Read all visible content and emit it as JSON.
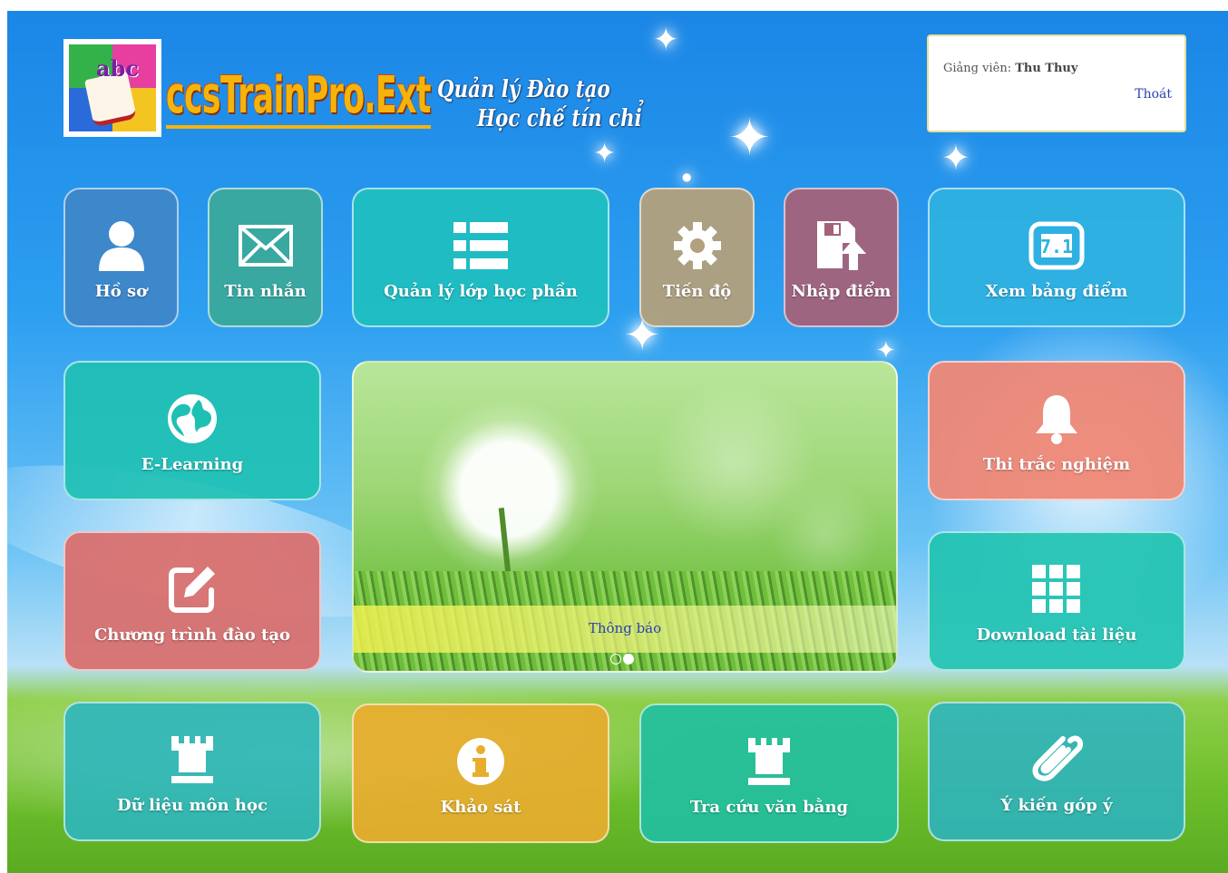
{
  "header": {
    "brand": "ccsTrainPro.Ext",
    "tagline_line1": "Quản lý Đào tạo",
    "tagline_line2": "Học chế tín chỉ",
    "logo_text": "abc"
  },
  "user": {
    "role_label": "Giảng viên: ",
    "name": "Thu Thuy",
    "logout": "Thoát"
  },
  "tiles": {
    "profile": {
      "label": "Hồ sơ",
      "icon": "user-icon",
      "color": "#3f86c8"
    },
    "messages": {
      "label": "Tin nhắn",
      "icon": "envelope-icon",
      "color": "#3aa99a"
    },
    "class_management": {
      "label": "Quản lý lớp học phần",
      "icon": "list-icon",
      "color": "#1fbfc0"
    },
    "progress": {
      "label": "Tiến độ",
      "icon": "gear-icon",
      "color": "#b3a07c"
    },
    "enter_grades": {
      "label": "Nhập điểm",
      "icon": "save-upload-icon",
      "color": "#a4627a"
    },
    "view_grades": {
      "label": "Xem bảng điểm",
      "icon": "grade-sheet-icon",
      "color": "#2fb3e0"
    },
    "elearning": {
      "label": "E-Learning",
      "icon": "globe-icon",
      "color": "#1fc0b4"
    },
    "curriculum": {
      "label": "Chương trình đào tạo",
      "icon": "edit-icon",
      "color": "#d9706f"
    },
    "quiz": {
      "label": "Thi trắc nghiệm",
      "icon": "bell-icon",
      "color": "#ef8876"
    },
    "download": {
      "label": "Download tài liệu",
      "icon": "grid-icon",
      "color": "#1fc3b0"
    },
    "course_data": {
      "label": "Dữ liệu môn học",
      "icon": "tower-icon",
      "color": "#2eb6bc"
    },
    "survey": {
      "label": "Khảo sát",
      "icon": "info-icon",
      "color": "#e8ad2e"
    },
    "diploma_lookup": {
      "label": "Tra cứu văn bằng",
      "icon": "tower-icon",
      "color": "#22bfa0"
    },
    "feedback": {
      "label": "Ý kiến góp ý",
      "icon": "paperclip-icon",
      "color": "#2ab3c4"
    }
  },
  "slider": {
    "caption": "Thông báo",
    "slide_count": 2,
    "active_slide": 2
  }
}
